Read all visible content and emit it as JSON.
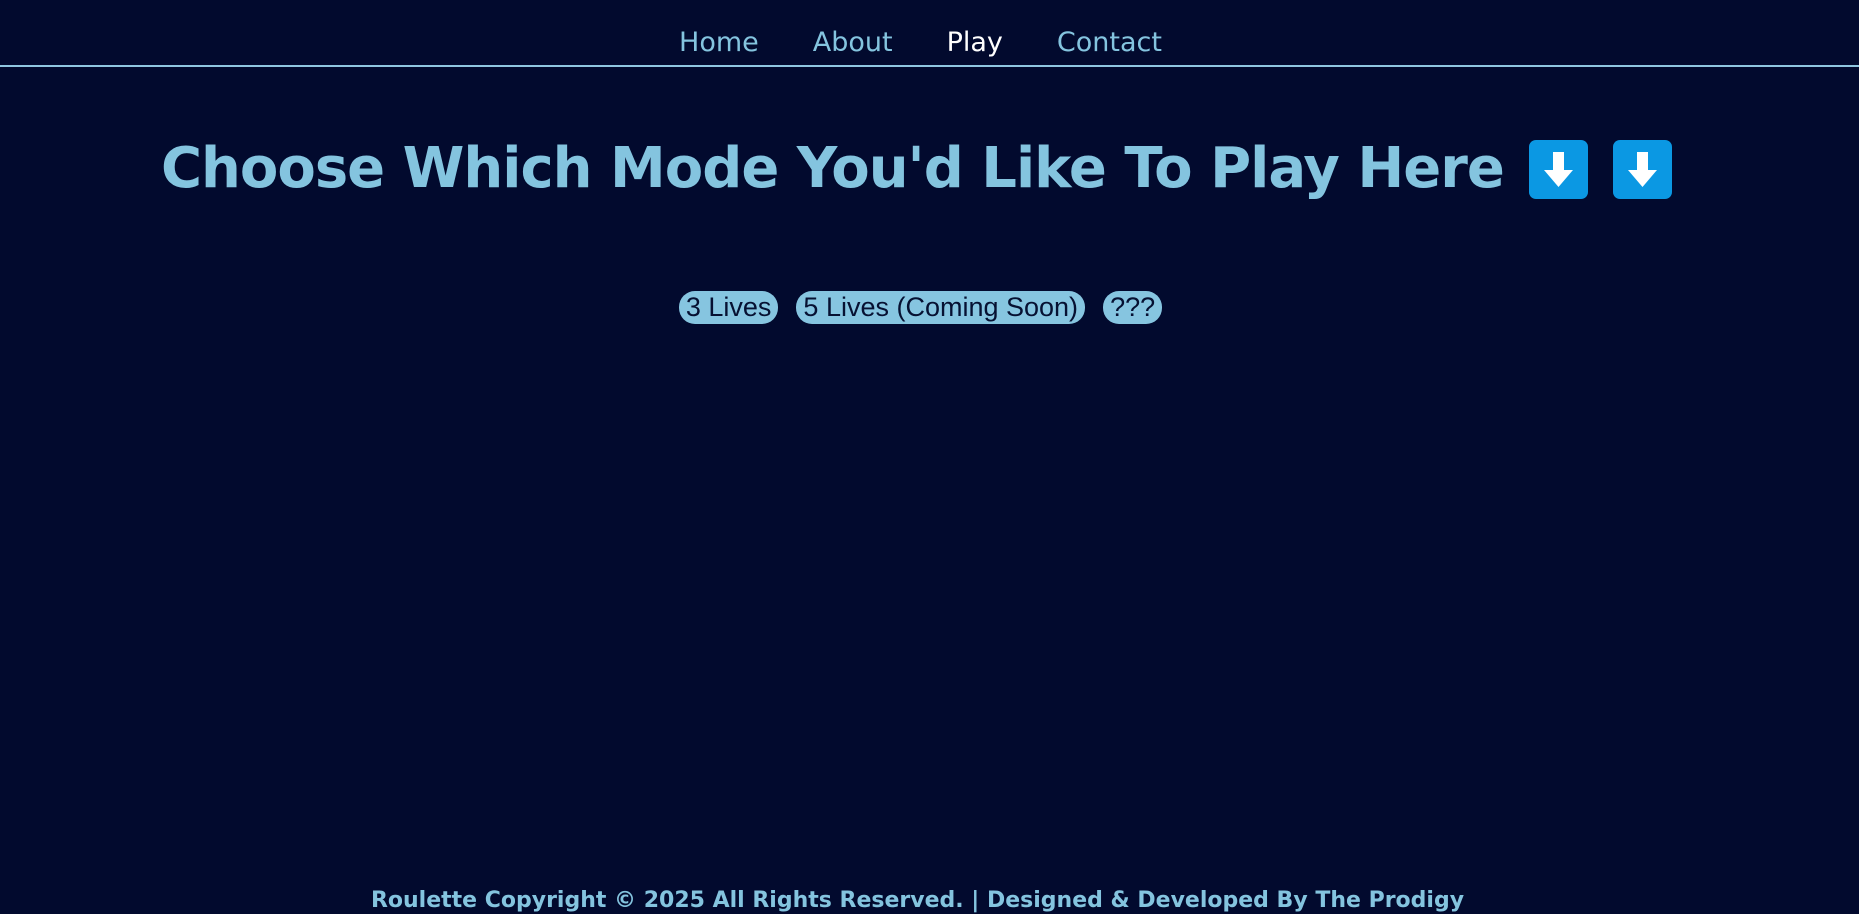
{
  "nav": {
    "items": [
      {
        "label": "Home"
      },
      {
        "label": "About"
      },
      {
        "label": "Play"
      },
      {
        "label": "Contact"
      }
    ],
    "active": "Play"
  },
  "main": {
    "title": "Choose Which Mode You'd Like To Play Here",
    "title_icons": [
      "down-arrow-emoji-icon",
      "down-arrow-emoji-icon"
    ],
    "modes": [
      {
        "label": "3 Lives"
      },
      {
        "label": "5 Lives (Coming Soon)"
      },
      {
        "label": "???"
      }
    ]
  },
  "footer": {
    "text": "Roulette Copyright © 2025 All Rights Reserved. | Designed & Developed By The Prodigy"
  },
  "colors": {
    "background": "#020a2e",
    "accent": "#84c4df",
    "active_nav": "#ffffff",
    "emoji_bg": "#0b98e3"
  }
}
